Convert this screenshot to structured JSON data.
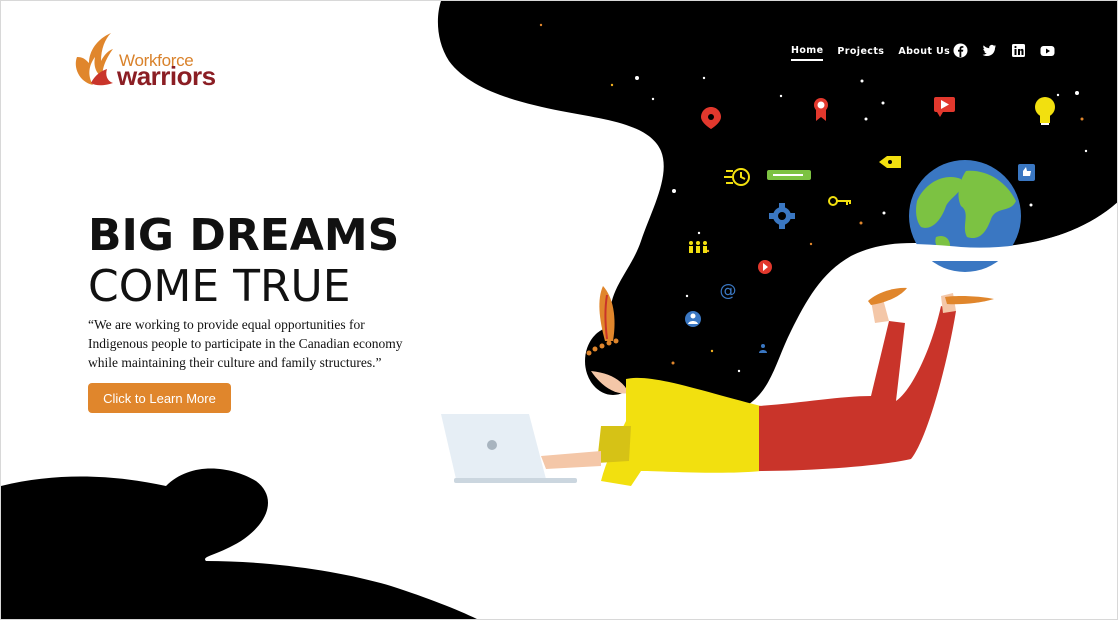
{
  "logo": {
    "line1": "Workforce",
    "line2": "warriors"
  },
  "nav": {
    "items": [
      {
        "label": "Home",
        "active": true
      },
      {
        "label": "Projects",
        "active": false
      },
      {
        "label": "About Us",
        "active": false
      }
    ],
    "social": [
      "facebook-icon",
      "twitter-icon",
      "linkedin-icon",
      "youtube-icon"
    ]
  },
  "hero": {
    "title_line1": "BIG DREAMS",
    "title_line2": "COME TRUE",
    "quote": "“We are working to provide equal opportunities for Indigenous people to participate in the Canadian economy while maintaining their culture and family structures.”",
    "cta_label": "Click to Learn More"
  },
  "colors": {
    "accent": "#e0862c",
    "brand_dark": "#8b1e24",
    "blob": "#000000",
    "shirt": "#f2e00f",
    "pants": "#c9342a"
  }
}
